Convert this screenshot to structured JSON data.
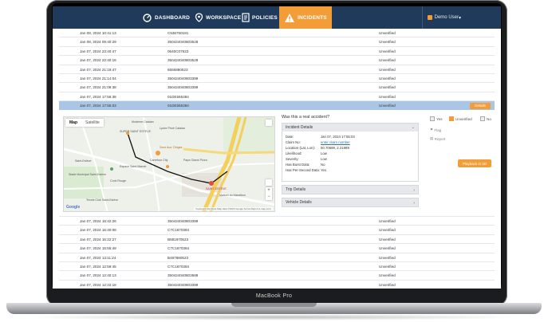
{
  "device": {
    "brand": "MacBook Pro"
  },
  "nav": {
    "items": [
      {
        "label": "DASHBOARD",
        "icon": "dashboard-icon"
      },
      {
        "label": "WORKSPACE",
        "icon": "workspace-icon"
      },
      {
        "label": "POLICIES",
        "icon": "policies-icon"
      },
      {
        "label": "INCIDENTS",
        "icon": "warning-icon",
        "active": true
      }
    ],
    "user": "Demo User"
  },
  "rows_top": [
    {
      "date": "Jan 08, 2024 10:41:13",
      "claim": "C536760181",
      "status": "Unverified"
    },
    {
      "date": "Jan 08, 2024 09:40:29",
      "claim": "350424040803528",
      "status": "Unverified"
    },
    {
      "date": "Jan 07, 2024 23:40:47",
      "claim": "0640C07623",
      "status": "Unverified"
    },
    {
      "date": "Jan 07, 2024 22:40:16",
      "claim": "350424040803528",
      "status": "Unverified"
    },
    {
      "date": "Jan 07, 2024 21:19:47",
      "claim": "6555880523",
      "status": "Unverified"
    },
    {
      "date": "Jan 07, 2024 21:14:04",
      "claim": "350424040803399",
      "status": "Unverified"
    },
    {
      "date": "Jan 07, 2024 21:09:38",
      "claim": "350424040803399",
      "status": "Unverified"
    },
    {
      "date": "Jan 07, 2024 17:56:38",
      "claim": "01DE565384",
      "status": "Unverified"
    },
    {
      "date": "Jan 07, 2024 17:55:03",
      "claim": "01DE565384",
      "status": "Unverified",
      "selected": true,
      "action": "Details"
    }
  ],
  "map": {
    "tabs": [
      "Map",
      "Satellite"
    ],
    "labels": {
      "l1": "SUPER SAINT ESTEVE",
      "l2": "Moderne Catalan",
      "l3": "Lycée Privé Catalan",
      "l4": "Zone Aux. Dinges",
      "l5": "Saint-Estève",
      "l6": "Carrefour City",
      "l7": "Stade Municipal Saint-Estève",
      "l8": "Espace Saint-Mamet",
      "l9": "Papa Gianni Pizza",
      "l10": "SAINT-ESTÈVE",
      "l11": "Maison du Marathon",
      "l12": "Tennis Club Saint-Estève",
      "l13": "Croix Rouge"
    },
    "attribution": "Keyboard shortcuts   Map data ©2024 Google   Terms   Report a map error",
    "logo": "Google"
  },
  "incident": {
    "question": "Was this a real accident?",
    "panel_title": "Incident Details",
    "fields": [
      {
        "k": "Date:",
        "v": "Jan 07, 2024 17:55:03"
      },
      {
        "k": "Claim No:",
        "v": "enter claim number",
        "link": true
      },
      {
        "k": "Location (Lat, Lon):",
        "v": "50.70699, 2.21989"
      },
      {
        "k": "Likelihood:",
        "v": "Low"
      },
      {
        "k": "Severity:",
        "v": "Low"
      },
      {
        "k": "Has Burst Data:",
        "v": "No"
      },
      {
        "k": "Has Per-Second Data:",
        "v": "Yes"
      }
    ],
    "trip": "Trip Details",
    "vehicle": "Vehicle Details"
  },
  "options": {
    "yes": "Yes",
    "unverified": "Unverified",
    "no": "No",
    "flag": "Flag",
    "report": "Report",
    "play": "Playback in 3D"
  },
  "rows_bottom": [
    {
      "date": "Jan 07, 2024 16:42:26",
      "claim": "350424040803399",
      "status": "Unverified"
    },
    {
      "date": "Jan 07, 2024 16:40:08",
      "claim": "C7C1670384",
      "status": "Unverified"
    },
    {
      "date": "Jan 07, 2024 16:22:27",
      "claim": "B581970523",
      "status": "Unverified"
    },
    {
      "date": "Jan 07, 2024 15:55:49",
      "claim": "C7C1670384",
      "status": "Unverified"
    },
    {
      "date": "Jan 07, 2024 13:11:24",
      "claim": "B467880523",
      "status": "Unverified"
    },
    {
      "date": "Jan 07, 2024 12:59:45",
      "claim": "C7C1670384",
      "status": "Unverified"
    },
    {
      "date": "Jan 07, 2024 12:40:13",
      "claim": "350424040803588",
      "status": "Unverified"
    },
    {
      "date": "Jan 07, 2024 12:22:18",
      "claim": "350424040803399",
      "status": "Unverified"
    }
  ]
}
